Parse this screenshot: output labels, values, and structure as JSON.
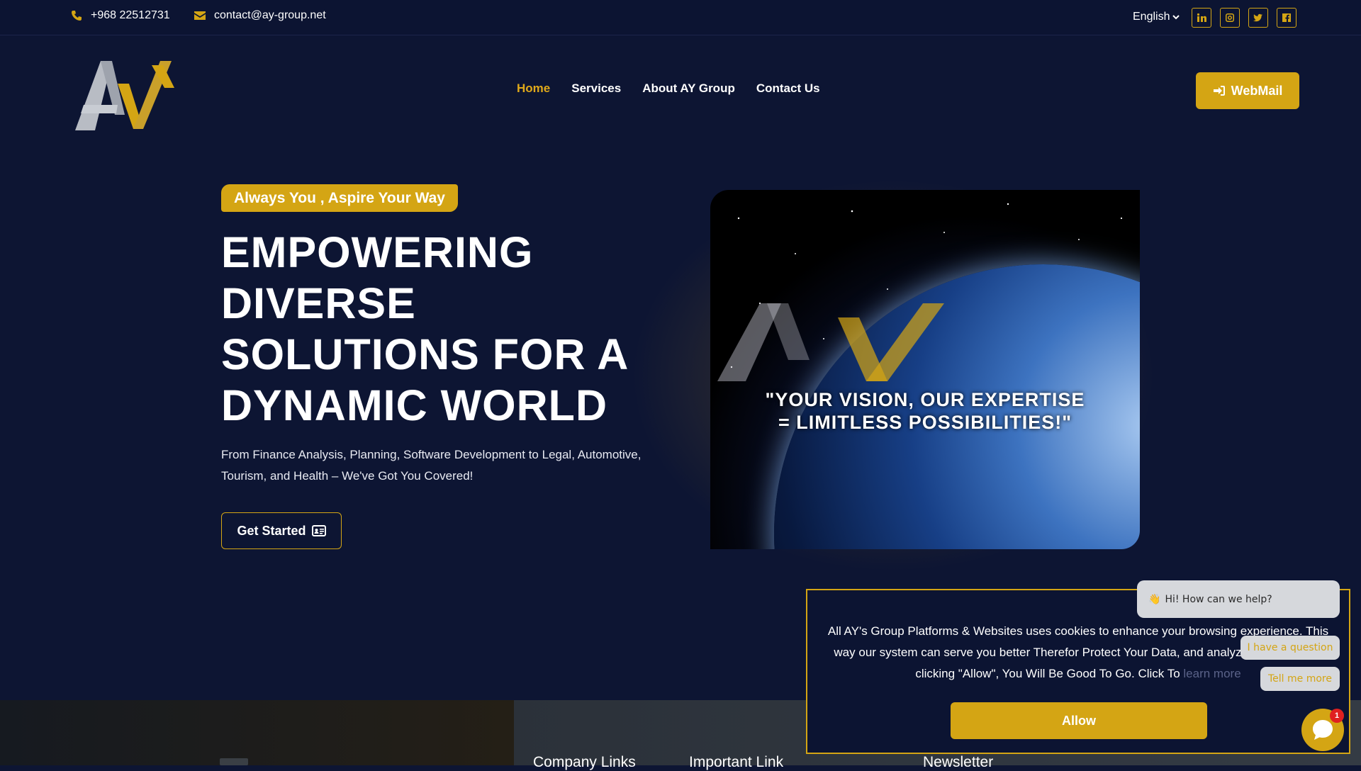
{
  "topbar": {
    "phone": "+968 22512731",
    "email": "contact@ay-group.net",
    "language": "English",
    "social": [
      "linkedin-icon",
      "instagram-icon",
      "twitter-icon",
      "facebook-icon"
    ]
  },
  "nav": {
    "logo": "AY",
    "items": [
      {
        "label": "Home",
        "active": true
      },
      {
        "label": "Services"
      },
      {
        "label": "About AY Group"
      },
      {
        "label": "Contact Us"
      }
    ],
    "webmail": "WebMail"
  },
  "hero": {
    "tagline": "Always You , Aspire Your Way",
    "headline": "EMPOWERING DIVERSE SOLUTIONS FOR A DYNAMIC WORLD",
    "subtext": "From Finance Analysis, Planning, Software Development to Legal, Automotive, Tourism, and Health – We've Got You Covered!",
    "cta": "Get Started",
    "image_quote_line1": "\"YOUR VISION, OUR EXPERTISE",
    "image_quote_line2": "= LIMITLESS POSSIBILITIES!\""
  },
  "footer": {
    "col1": "Company Links",
    "col2": "Important Link",
    "col3": "Newsletter"
  },
  "cookie": {
    "text": "All AY's Group Platforms & Websites uses cookies to enhance your browsing experience. This way our system can serve you better Therefor Protect Your Data, and analyze our traffic. By clicking \"Allow\", You Will Be Good To Go. Click To",
    "link": "learn more",
    "allow": "Allow"
  },
  "chat": {
    "greeting": "Hi! How can we help?",
    "option1": "I have a question",
    "option2": "Tell me more",
    "badge": "1"
  },
  "colors": {
    "accent": "#d4a514",
    "background": "#0d1533"
  }
}
